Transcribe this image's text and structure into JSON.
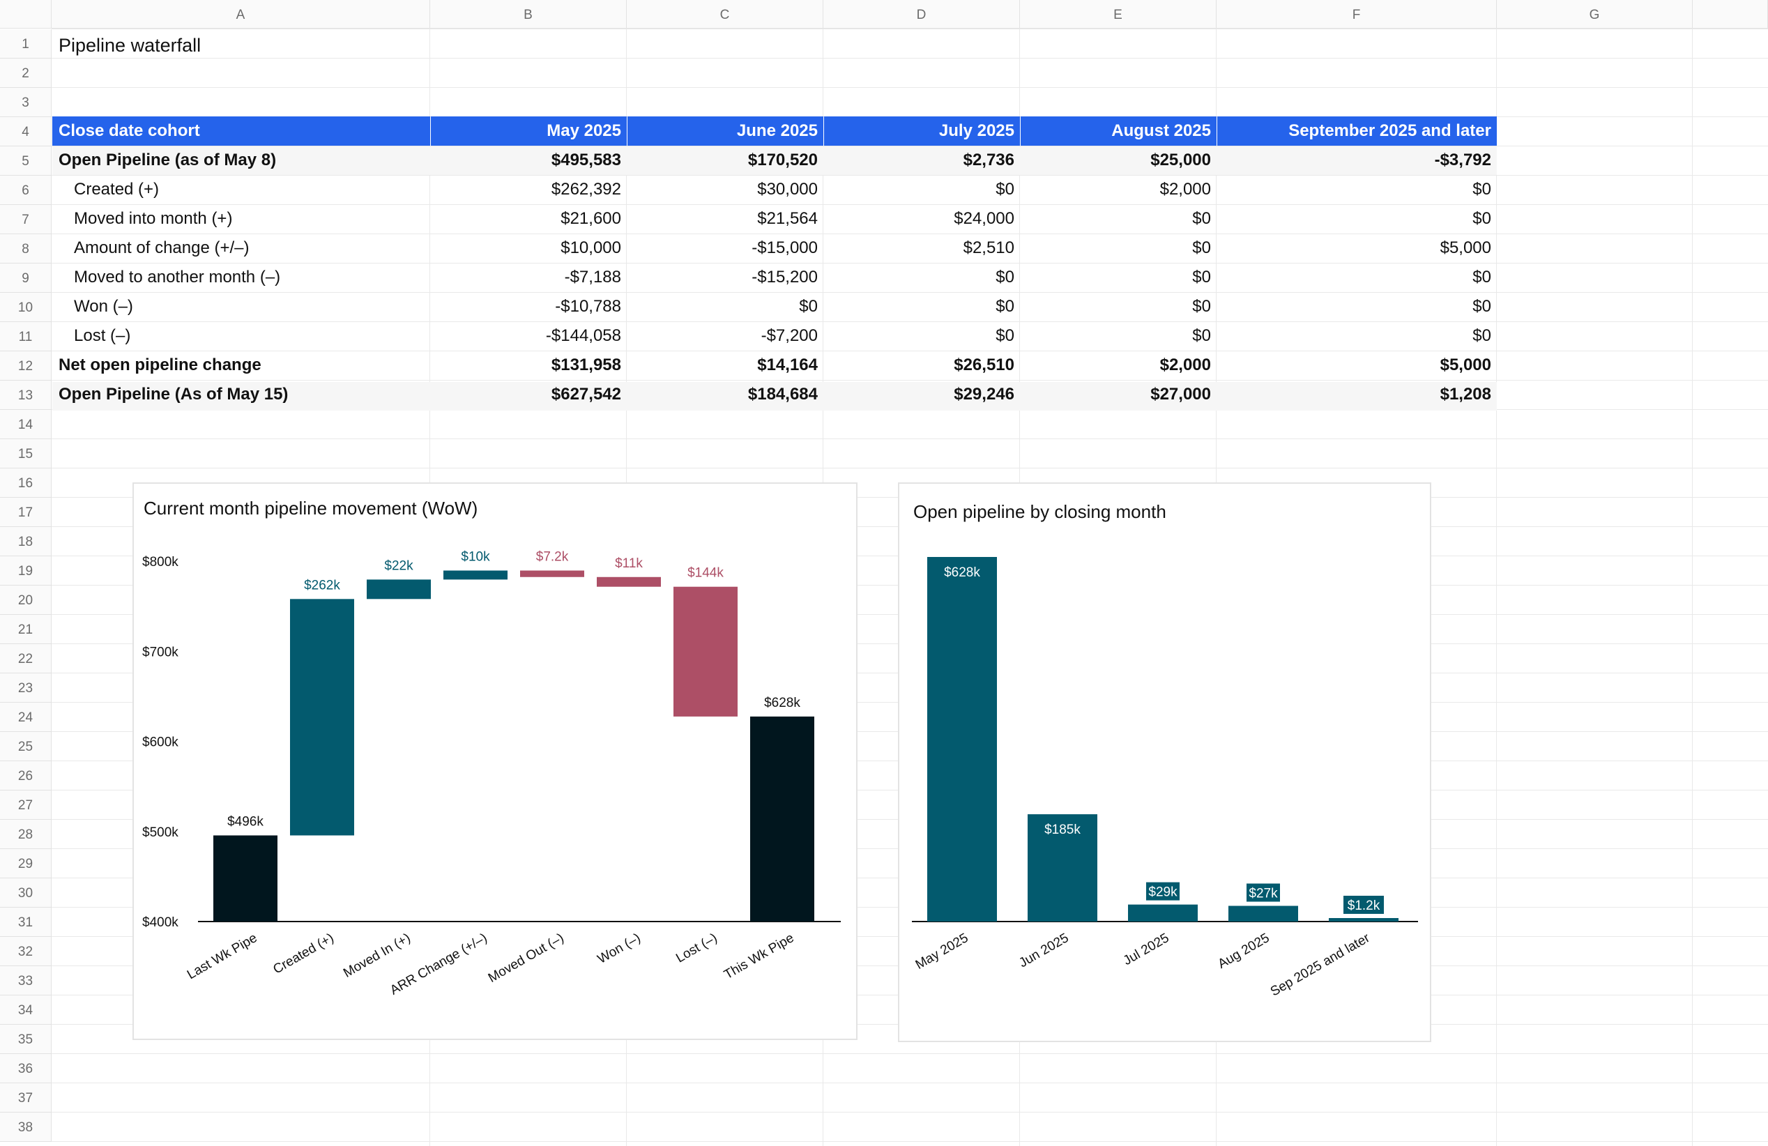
{
  "sheet": {
    "columns": [
      "A",
      "B",
      "C",
      "D",
      "E",
      "F",
      "G"
    ],
    "rows": [
      "1",
      "2",
      "3",
      "4",
      "5",
      "6",
      "7",
      "8",
      "9",
      "10",
      "11",
      "12",
      "13",
      "14",
      "15",
      "16",
      "17",
      "18",
      "19",
      "20",
      "21",
      "22",
      "23",
      "24",
      "25",
      "26",
      "27",
      "28",
      "29",
      "30",
      "31",
      "32",
      "33",
      "34",
      "35",
      "36",
      "37",
      "38"
    ]
  },
  "table": {
    "title": "Pipeline waterfall",
    "header": [
      "Close date cohort",
      "May 2025",
      "June 2025",
      "July 2025",
      "August 2025",
      "September 2025 and later"
    ],
    "rows": [
      {
        "label": "Open Pipeline (as of May 8)",
        "values": [
          "$495,583",
          "$170,520",
          "$2,736",
          "$25,000",
          "-$3,792"
        ]
      },
      {
        "label": "Created (+)",
        "values": [
          "$262,392",
          "$30,000",
          "$0",
          "$2,000",
          "$0"
        ]
      },
      {
        "label": "Moved into month (+)",
        "values": [
          "$21,600",
          "$21,564",
          "$24,000",
          "$0",
          "$0"
        ]
      },
      {
        "label": "Amount of change (+/–)",
        "values": [
          "$10,000",
          "-$15,000",
          "$2,510",
          "$0",
          "$5,000"
        ]
      },
      {
        "label": "Moved to another month (–)",
        "values": [
          "-$7,188",
          "-$15,200",
          "$0",
          "$0",
          "$0"
        ]
      },
      {
        "label": "Won (–)",
        "values": [
          "-$10,788",
          "$0",
          "$0",
          "$0",
          "$0"
        ]
      },
      {
        "label": "Lost (–)",
        "values": [
          "-$144,058",
          "-$7,200",
          "$0",
          "$0",
          "$0"
        ]
      },
      {
        "label": "Net open pipeline change",
        "values": [
          "$131,958",
          "$14,164",
          "$26,510",
          "$2,000",
          "$5,000"
        ]
      },
      {
        "label": "Open Pipeline (As of May 15)",
        "values": [
          "$627,542",
          "$184,684",
          "$29,246",
          "$27,000",
          "$1,208"
        ]
      }
    ]
  },
  "colors": {
    "header_blue": "#2563eb",
    "increase_teal": "#035a6e",
    "decrease_rose": "#ad4f66",
    "total_dark": "#01161e",
    "label_teal": "#035a6e",
    "label_rose": "#ad4f66"
  },
  "chart_data": [
    {
      "type": "bar",
      "subtype": "waterfall",
      "title": "Current month pipeline movement (WoW)",
      "categories": [
        "Last Wk Pipe",
        "Created (+)",
        "Moved In (+)",
        "ARR Change (+/–)",
        "Moved Out (–)",
        "Won (–)",
        "Lost (–)",
        "This Wk Pipe"
      ],
      "kinds": [
        "total",
        "increase",
        "increase",
        "increase",
        "decrease",
        "decrease",
        "decrease",
        "total"
      ],
      "values": [
        495583,
        262392,
        21600,
        10000,
        -7188,
        -10788,
        -144058,
        627542
      ],
      "labels": [
        "$496k",
        "$262k",
        "$22k",
        "$10k",
        "$7.2k",
        "$11k",
        "$144k",
        "$628k"
      ],
      "ylim": [
        400000,
        800000
      ],
      "yticks": [
        400000,
        500000,
        600000,
        700000,
        800000
      ],
      "yticklabels": [
        "$400k",
        "$500k",
        "$600k",
        "$700k",
        "$800k"
      ],
      "xlabel": "",
      "ylabel": "",
      "legend": "none",
      "grid": false
    },
    {
      "type": "bar",
      "title": "Open pipeline by closing month",
      "categories": [
        "May 2025",
        "Jun 2025",
        "Jul 2025",
        "Aug 2025",
        "Sep 2025 and later"
      ],
      "values": [
        627542,
        184684,
        29246,
        27000,
        1208
      ],
      "labels": [
        "$628k",
        "$185k",
        "$29k",
        "$27k",
        "$1.2k"
      ],
      "ylim": [
        0,
        627542
      ],
      "xlabel": "",
      "ylabel": "",
      "legend": "none",
      "grid": false
    }
  ]
}
